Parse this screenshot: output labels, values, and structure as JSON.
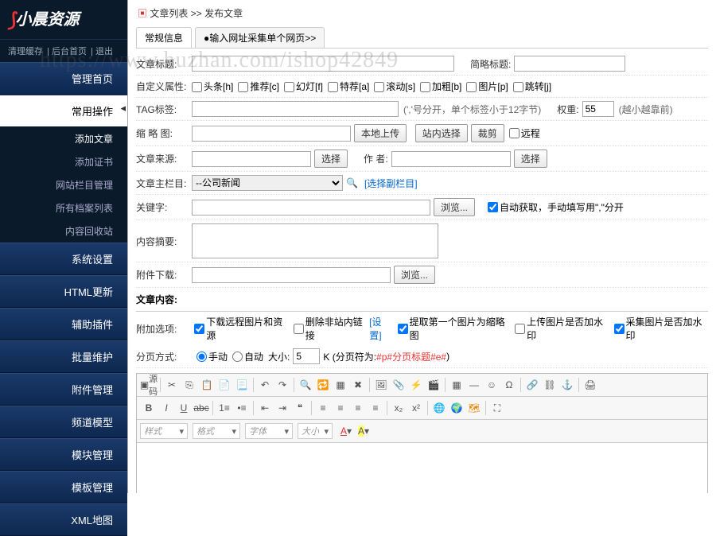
{
  "logo_text": "小晨资源",
  "watermark": "https://www.huzhan.com/ishop42849",
  "top_links": [
    "清理缓存",
    "后台首页",
    "退出"
  ],
  "nav": {
    "home": "管理首页",
    "common_ops": "常用操作",
    "subs": {
      "add_article": "添加文章",
      "add_cert": "添加证书",
      "columns": "网站栏目管理",
      "archives": "所有档案列表",
      "recycle": "内容回收站"
    },
    "sys": "系统设置",
    "html": "HTML更新",
    "plugin": "辅助插件",
    "batch": "批量维护",
    "attach": "附件管理",
    "channel": "频道模型",
    "module": "模块管理",
    "template": "模板管理",
    "xml": "XML地图"
  },
  "breadcrumb": {
    "a": "文章列表",
    "b": "发布文章"
  },
  "tabs": {
    "t1": "常规信息",
    "t2": "●输入网址采集单个网页>>"
  },
  "labels": {
    "title": "文章标题:",
    "short": "简略标题:",
    "custom": "自定义属性:",
    "tag": "TAG标签:",
    "tag_hint": "(','号分开，单个标签小于12字节)",
    "weight": "权重:",
    "weight_hint": "(越小越靠前)",
    "weight_val": "55",
    "thumb": "缩 略 图:",
    "local_upload": "本地上传",
    "site_select": "站内选择",
    "crop": "裁剪",
    "remote": "远程",
    "source": "文章来源:",
    "select": "选择",
    "author": "作 者:",
    "main_col": "文章主栏目:",
    "main_col_val": "--公司新闻",
    "pick_sub": "[选择副栏目]",
    "keywords": "关键字:",
    "browse": "浏览...",
    "auto_get": "自动获取，手动填写用\",\"分开",
    "summary": "内容摘要:",
    "attach_dl": "附件下载:",
    "content": "文章内容:",
    "addons": "附加选项:",
    "opt1": "下载远程图片和资源",
    "opt2": "删除非站内链接",
    "opt2_set": "[设置]",
    "opt3": "提取第一个图片为缩略图",
    "opt4": "上传图片是否加水印",
    "opt5": "采集图片是否加水印",
    "paging": "分页方式:",
    "manual": "手动",
    "auto": "自动",
    "size": "大小:",
    "size_val": "5",
    "k": "K (分页符为:",
    "pagetag": "#p#分页标题#e#",
    ")": ")",
    "source_code": "源码"
  },
  "custom_attrs": [
    "头条[h]",
    "推荐[c]",
    "幻灯[f]",
    "特荐[a]",
    "滚动[s]",
    "加粗[b]",
    "图片[p]",
    "跳转[j]"
  ],
  "editor_dd": {
    "style": "样式",
    "format": "格式",
    "font": "字体",
    "size": "大小"
  }
}
